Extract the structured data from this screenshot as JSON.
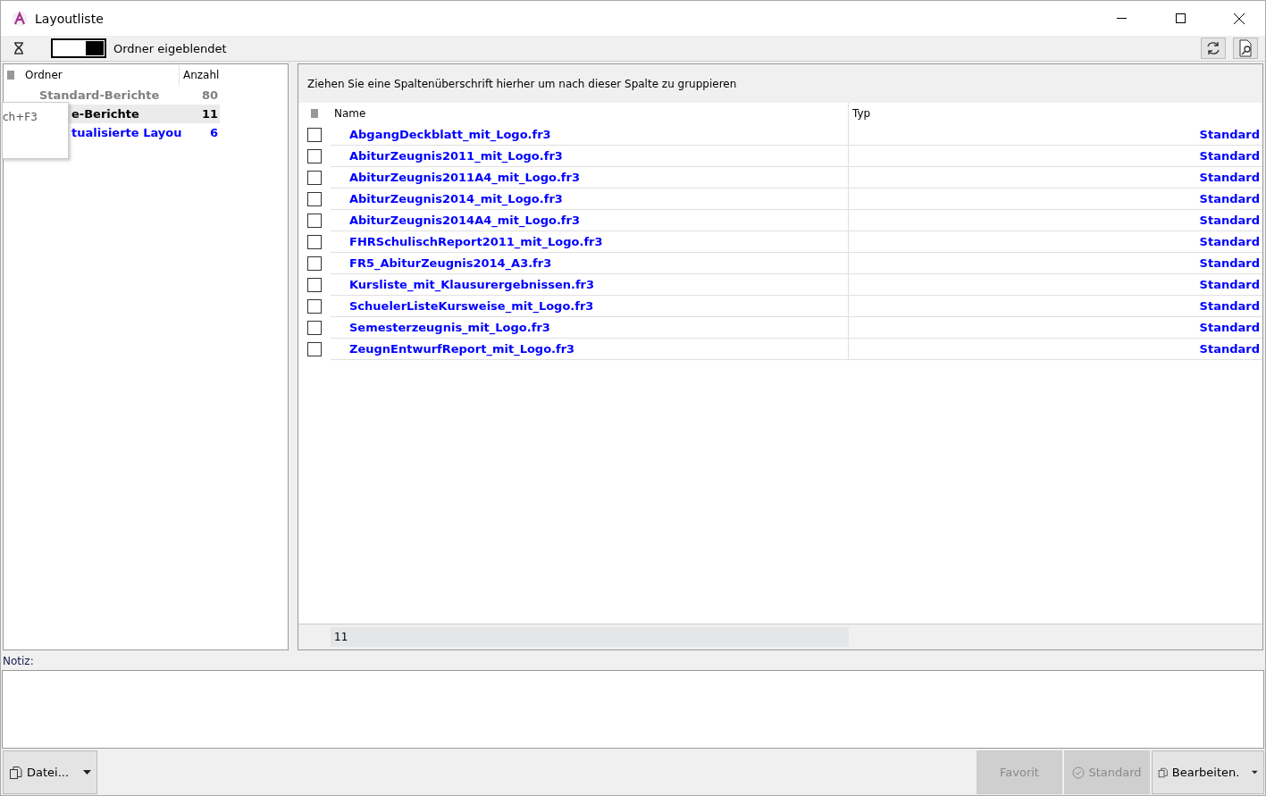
{
  "window": {
    "title": "Layoutliste"
  },
  "toolbar": {
    "folder_toggle": {
      "on": true,
      "label": "Ordner eigeblendet"
    }
  },
  "folder_tree": {
    "columns": [
      "Ordner",
      "Anzahl"
    ],
    "rows": [
      {
        "kind": "standard",
        "name": "Standard-Berichte",
        "count": "80",
        "selected": false
      },
      {
        "kind": "user",
        "name": "e-Berichte",
        "count": "11",
        "selected": true
      },
      {
        "kind": "updated",
        "name": "tualisierte Layou",
        "count": "6",
        "selected": false
      }
    ]
  },
  "tooltip": {
    "text": "ch+F3"
  },
  "grid": {
    "group_hint": "Ziehen Sie eine Spaltenüberschrift hierher um nach dieser Spalte zu gruppieren",
    "columns": [
      "Name",
      "Typ"
    ],
    "rows": [
      {
        "name": "AbgangDeckblatt_mit_Logo.fr3",
        "type": "Standard",
        "checked": false
      },
      {
        "name": "AbiturZeugnis2011_mit_Logo.fr3",
        "type": "Standard",
        "checked": false
      },
      {
        "name": "AbiturZeugnis2011A4_mit_Logo.fr3",
        "type": "Standard",
        "checked": false
      },
      {
        "name": "AbiturZeugnis2014_mit_Logo.fr3",
        "type": "Standard",
        "checked": false
      },
      {
        "name": "AbiturZeugnis2014A4_mit_Logo.fr3",
        "type": "Standard",
        "checked": false
      },
      {
        "name": "FHRSchulischReport2011_mit_Logo.fr3",
        "type": "Standard",
        "checked": false
      },
      {
        "name": "FR5_AbiturZeugnis2014_A3.fr3",
        "type": "Standard",
        "checked": false
      },
      {
        "name": "Kursliste_mit_Klausurergebnissen.fr3",
        "type": "Standard",
        "checked": false
      },
      {
        "name": "SchuelerListeKursweise_mit_Logo.fr3",
        "type": "Standard",
        "checked": false
      },
      {
        "name": "Semesterzeugnis_mit_Logo.fr3",
        "type": "Standard",
        "checked": false
      },
      {
        "name": "ZeugnEntwurfReport_mit_Logo.fr3",
        "type": "Standard",
        "checked": false
      }
    ],
    "footer_count": "11"
  },
  "notes": {
    "label": "Notiz:"
  },
  "buttons": [
    {
      "kind": "menu",
      "label": "Datei...",
      "disabled": false
    },
    {
      "kind": "spacer"
    },
    {
      "kind": "plain",
      "label": "Favorit",
      "disabled": true
    },
    {
      "kind": "check",
      "label": "Standard",
      "disabled": true
    },
    {
      "kind": "menu",
      "label": "Bearbeiten.",
      "disabled": false
    }
  ]
}
